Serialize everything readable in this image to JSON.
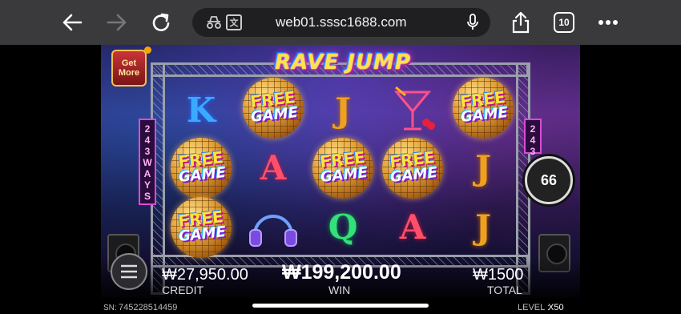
{
  "browser": {
    "url": "web01.sssc1688.com",
    "tab_count": "10",
    "icons": [
      "back-arrow-icon",
      "forward-arrow-icon",
      "reload-icon",
      "incognito-icon",
      "translate-icon",
      "microphone-icon",
      "share-icon",
      "tabs-icon",
      "more-icon"
    ]
  },
  "game": {
    "title": "RAVE JUMP",
    "get_more": "Get More",
    "ways_digits": [
      "2",
      "4",
      "3"
    ],
    "ways_word": [
      "W",
      "A",
      "Y",
      "S"
    ],
    "spin_count": "66",
    "symbols": {
      "freegame_top": "FREE",
      "freegame_bottom": "GAME",
      "k": "K",
      "j": "J",
      "a": "A",
      "q": "Q"
    },
    "credit_value": "₩27,950.00",
    "credit_label": "CREDIT",
    "win_value": "₩199,200.00",
    "win_label": "WIN",
    "total_value": "₩1500",
    "total_label": "TOTAL",
    "sn_label": "SN:",
    "sn_value": "745228514459",
    "level_label": "LEVEL :",
    "level_value": "X50"
  },
  "colors": {
    "neon_k": "#3aa9ff",
    "neon_j": "#f0a020",
    "neon_a": "#ff4f6a",
    "neon_q": "#33e07a"
  }
}
